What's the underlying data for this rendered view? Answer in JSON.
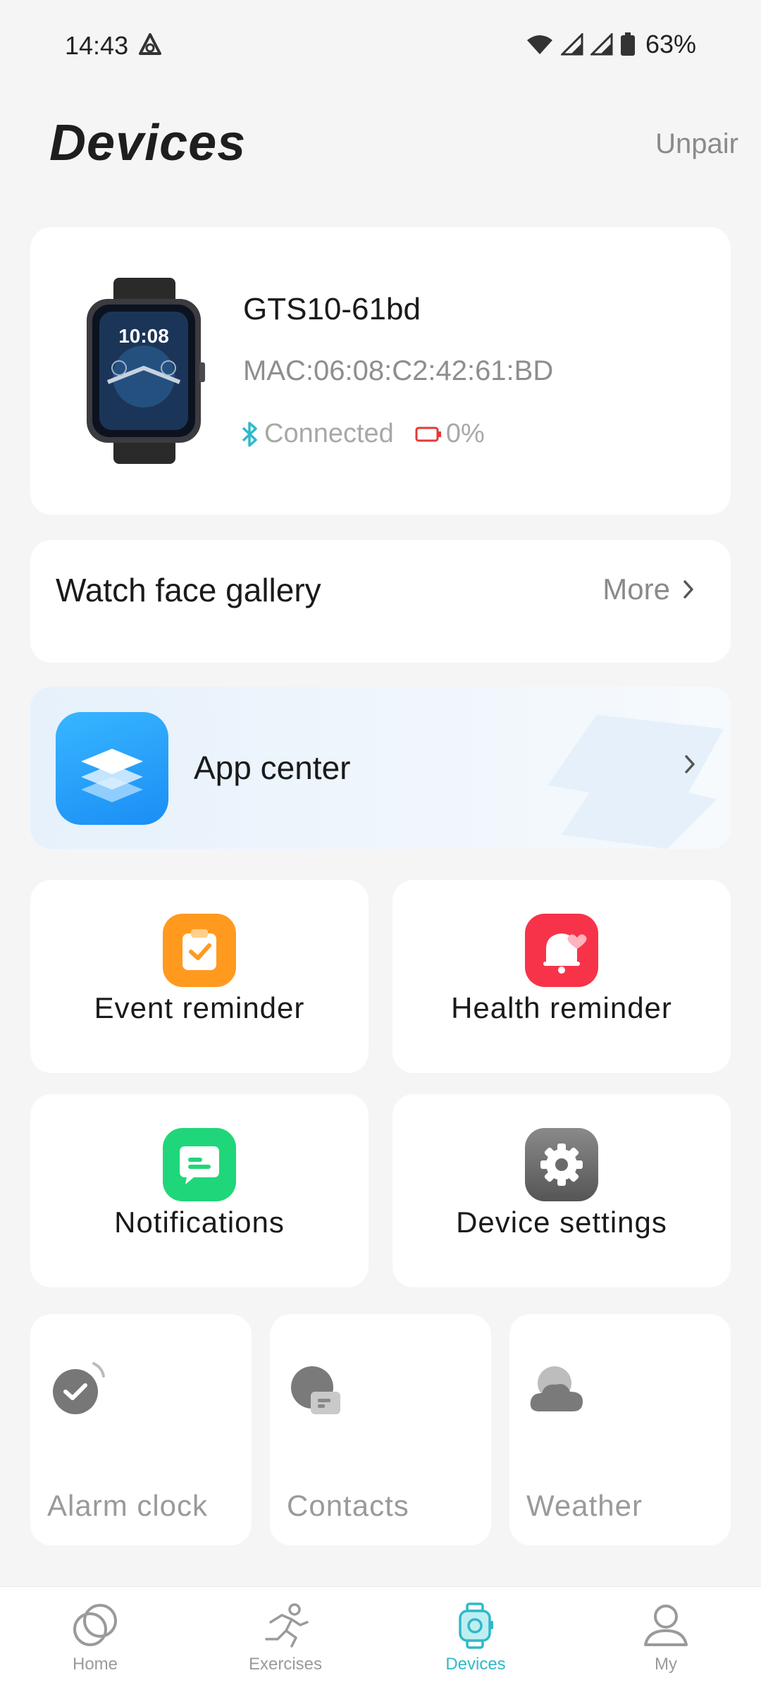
{
  "status_bar": {
    "time": "14:43",
    "battery_percent": "63%"
  },
  "header": {
    "title": "Devices",
    "unpair_label": "Unpair"
  },
  "device": {
    "name": "GTS10-61bd",
    "mac": "MAC:06:08:C2:42:61:BD",
    "connection_status": "Connected",
    "battery": "0%",
    "watch_face_time": "10:08"
  },
  "watch_face_gallery": {
    "title": "Watch face gallery",
    "more_label": "More"
  },
  "app_center": {
    "title": "App center"
  },
  "features": [
    {
      "label": "Event reminder",
      "icon": "clipboard-check-icon",
      "color": "#ff9a1f"
    },
    {
      "label": "Health reminder",
      "icon": "bell-heart-icon",
      "color": "#f7334a"
    },
    {
      "label": "Notifications",
      "icon": "chat-bubble-icon",
      "color": "#1fd67a"
    },
    {
      "label": "Device settings",
      "icon": "gear-icon",
      "color": "#6b6b6b"
    }
  ],
  "small_features": [
    {
      "label": "Alarm clock",
      "icon": "alarm-check-icon"
    },
    {
      "label": "Contacts",
      "icon": "contacts-icon"
    },
    {
      "label": "Weather",
      "icon": "cloud-icon"
    }
  ],
  "bottom_nav": {
    "items": [
      {
        "label": "Home",
        "icon": "home-rings-icon",
        "active": false
      },
      {
        "label": "Exercises",
        "icon": "running-icon",
        "active": false
      },
      {
        "label": "Devices",
        "icon": "watch-icon",
        "active": true
      },
      {
        "label": "My",
        "icon": "person-icon",
        "active": false
      }
    ],
    "active_color": "#2fb9c9",
    "inactive_color": "#9a9a9a"
  },
  "colors": {
    "bluetooth": "#2fb9c9",
    "battery_low": "#e53935",
    "app_center_blue": "#1a8ef5"
  }
}
